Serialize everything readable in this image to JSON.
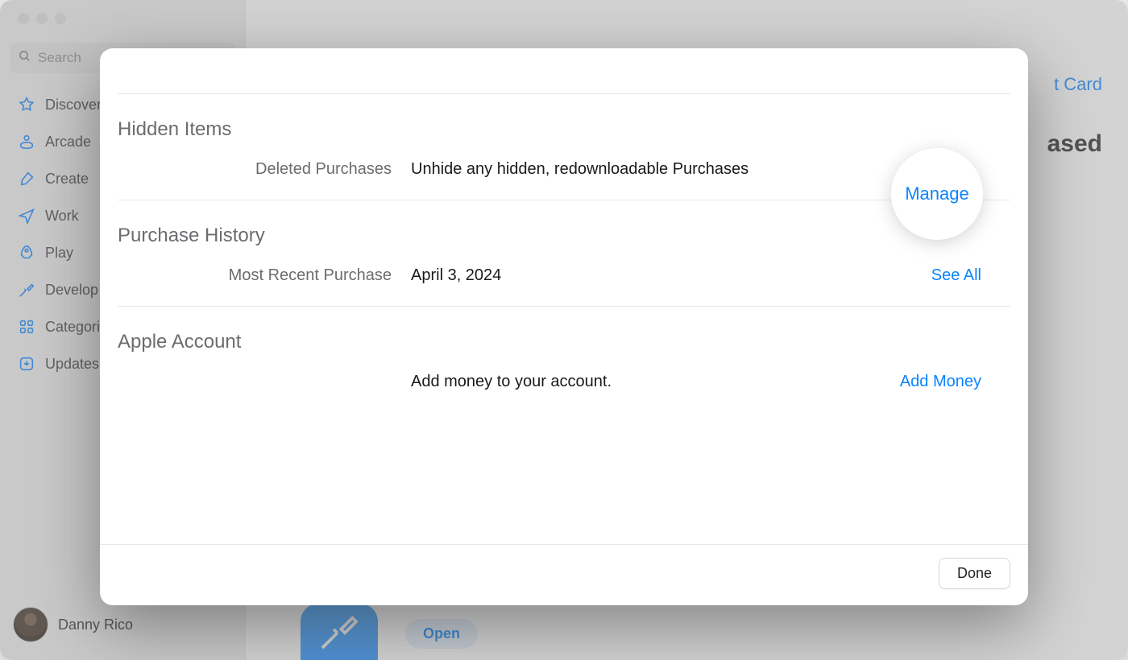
{
  "sidebar": {
    "search_placeholder": "Search",
    "items": [
      {
        "label": "Discover",
        "icon": "star-icon"
      },
      {
        "label": "Arcade",
        "icon": "arcade-icon"
      },
      {
        "label": "Create",
        "icon": "brush-icon"
      },
      {
        "label": "Work",
        "icon": "send-icon"
      },
      {
        "label": "Play",
        "icon": "rocket-icon"
      },
      {
        "label": "Develop",
        "icon": "hammer-icon"
      },
      {
        "label": "Categories",
        "icon": "grid-icon"
      },
      {
        "label": "Updates",
        "icon": "download-icon"
      }
    ],
    "user_name": "Danny Rico"
  },
  "background": {
    "link_right_top": "t Card",
    "heading_right": "ased",
    "open_label": "Open"
  },
  "sheet": {
    "sections": {
      "hidden": {
        "title": "Hidden Items",
        "label": "Deleted Purchases",
        "value": "Unhide any hidden, redownloadable Purchases",
        "action": "Manage"
      },
      "history": {
        "title": "Purchase History",
        "label": "Most Recent Purchase",
        "value": "April 3, 2024",
        "action": "See All"
      },
      "account": {
        "title": "Apple Account",
        "label": "",
        "value": "Add money to your account.",
        "action": "Add Money"
      }
    },
    "done": "Done"
  },
  "colors": {
    "accent": "#0a84ff"
  }
}
